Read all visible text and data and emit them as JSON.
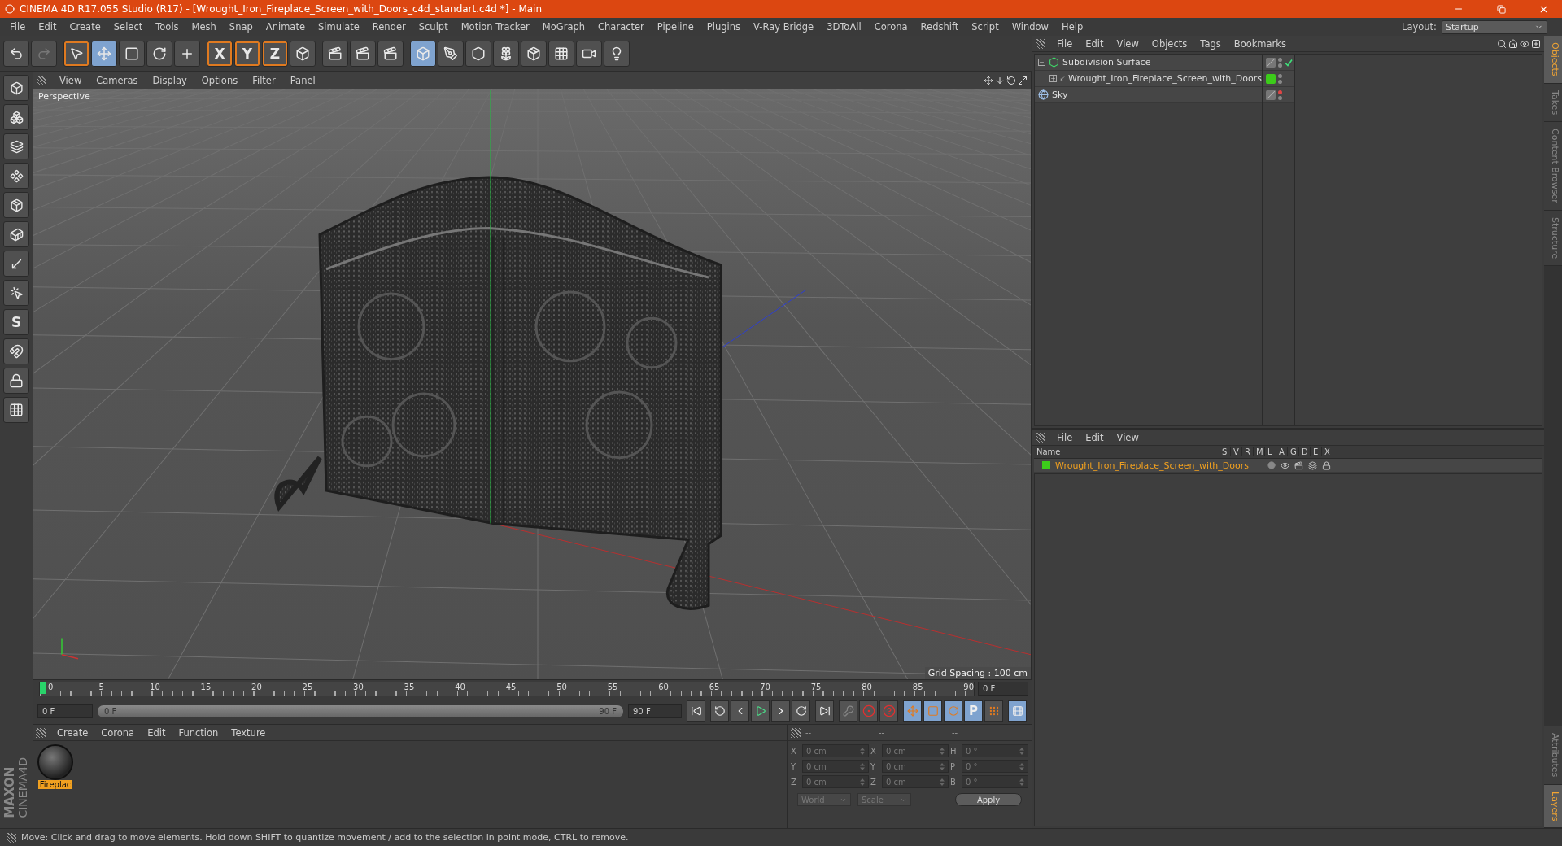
{
  "title_bar": {
    "title": "CINEMA 4D R17.055 Studio (R17) - [Wrought_Iron_Fireplace_Screen_with_Doors_c4d_standart.c4d *] - Main"
  },
  "menu": [
    "File",
    "Edit",
    "Create",
    "Select",
    "Tools",
    "Mesh",
    "Snap",
    "Animate",
    "Simulate",
    "Render",
    "Sculpt",
    "Motion Tracker",
    "MoGraph",
    "Character",
    "Pipeline",
    "Plugins",
    "V-Ray Bridge",
    "3DToAll",
    "Corona",
    "Redshift",
    "Script",
    "Window",
    "Help"
  ],
  "layout": {
    "label": "Layout:",
    "value": "Startup"
  },
  "toolbar": {
    "axis_buttons": [
      "X",
      "Y",
      "Z"
    ]
  },
  "left_tools": {
    "snap_label": "S"
  },
  "viewport": {
    "menu": [
      "View",
      "Cameras",
      "Display",
      "Options",
      "Filter",
      "Panel"
    ],
    "camera": "Perspective",
    "grid_spacing": "Grid Spacing : 100 cm"
  },
  "timeline": {
    "ticks": [
      "0",
      "5",
      "10",
      "15",
      "20",
      "25",
      "30",
      "35",
      "40",
      "45",
      "50",
      "55",
      "60",
      "65",
      "70",
      "75",
      "80",
      "85",
      "90"
    ],
    "current_frame": "0 F",
    "start": "0 F",
    "range": {
      "start": "0 F",
      "end": "90 F",
      "level": 1
    },
    "end": "90 F",
    "key_label": "P"
  },
  "materials": {
    "menu": [
      "Create",
      "Corona",
      "Edit",
      "Function",
      "Texture"
    ],
    "items": [
      {
        "name": "Fireplac",
        "selected": true
      }
    ]
  },
  "coordinates": {
    "headers": [
      "--",
      "--",
      "--"
    ],
    "rows": [
      {
        "axis": "X",
        "position": "0 cm",
        "size_axis": "X",
        "size": "0 cm",
        "rot_axis": "H",
        "rotation": "0 °"
      },
      {
        "axis": "Y",
        "position": "0 cm",
        "size_axis": "Y",
        "size": "0 cm",
        "rot_axis": "P",
        "rotation": "0 °"
      },
      {
        "axis": "Z",
        "position": "0 cm",
        "size_axis": "Z",
        "size": "0 cm",
        "rot_axis": "B",
        "rotation": "0 °"
      }
    ],
    "mode": "World",
    "size_mode": "Scale",
    "apply": "Apply"
  },
  "objects": {
    "menu": [
      "File",
      "Edit",
      "View",
      "Objects",
      "Tags",
      "Bookmarks"
    ],
    "tree": [
      {
        "name": "Subdivision Surface",
        "kind": "subdivision",
        "expanded": true,
        "checked": true,
        "editor_hidden": false,
        "has_layer": false,
        "children": [
          {
            "name": "Wrought_Iron_Fireplace_Screen_with_Doors",
            "kind": "null",
            "expanded": false,
            "checked": false,
            "editor_hidden": false,
            "has_layer": true
          }
        ]
      },
      {
        "name": "Sky",
        "kind": "sky",
        "checked": false,
        "editor_hidden": true,
        "has_layer": false
      }
    ]
  },
  "layers": {
    "menu": [
      "File",
      "Edit",
      "View"
    ],
    "columns": [
      "Name",
      "S",
      "V",
      "R",
      "M",
      "L",
      "A",
      "G",
      "D",
      "E",
      "X"
    ],
    "rows": [
      {
        "name": "Wrought_Iron_Fireplace_Screen_with_Doors",
        "color": "#3ccc1a"
      }
    ]
  },
  "side_tabs": [
    {
      "label": "Objects",
      "selected": true
    },
    {
      "label": "Takes",
      "selected": false
    },
    {
      "label": "Content Browser",
      "selected": false
    },
    {
      "label": "Structure",
      "selected": false
    }
  ],
  "side_tabs_bottom": [
    {
      "label": "Attributes",
      "selected": false
    },
    {
      "label": "Layers",
      "selected": true
    }
  ],
  "logo": {
    "brand": "MAXON",
    "product": "CINEMA4D"
  },
  "status_bar": {
    "text": "Move: Click and drag to move elements. Hold down SHIFT to quantize movement / add to the selection in point mode, CTRL to remove."
  }
}
